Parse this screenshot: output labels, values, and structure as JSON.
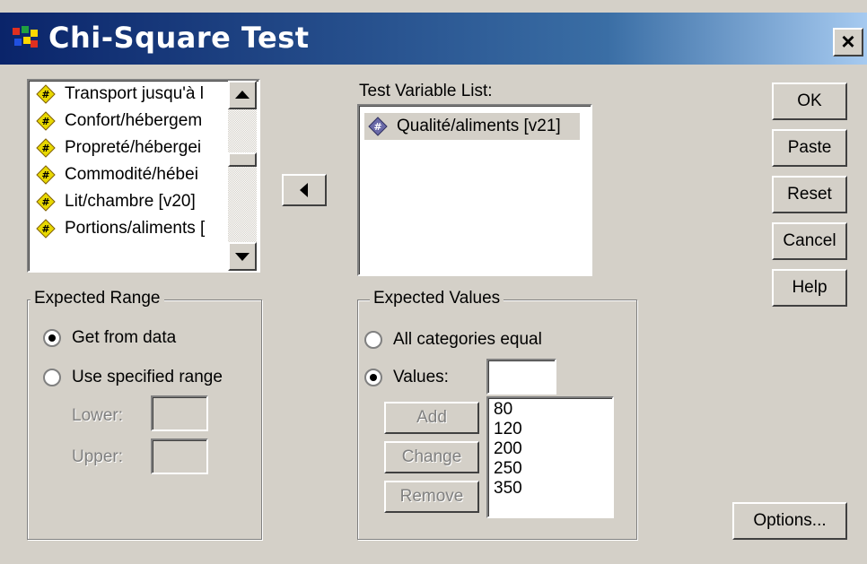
{
  "window": {
    "title": "Chi-Square Test",
    "close_label": "×"
  },
  "source_list": {
    "items": [
      {
        "label": "Transport jusqu'à l"
      },
      {
        "label": "Confort/hébergem"
      },
      {
        "label": "Propreté/hébergei"
      },
      {
        "label": "Commodité/hébei"
      },
      {
        "label": "Lit/chambre [v20]"
      },
      {
        "label": "Portions/aliments ["
      }
    ]
  },
  "move_button": {
    "icon": "arrow-left-icon"
  },
  "test_variables": {
    "label": "Test Variable List:",
    "items": [
      {
        "label": "Qualité/aliments [v21]"
      }
    ]
  },
  "buttons": {
    "ok": "OK",
    "paste": "Paste",
    "reset": "Reset",
    "cancel": "Cancel",
    "help": "Help",
    "options": "Options..."
  },
  "expected_range": {
    "title": "Expected Range",
    "get_from_data": "Get from data",
    "use_specified": "Use specified range",
    "selected": "get_from_data",
    "lower_label": "Lower:",
    "upper_label": "Upper:",
    "lower_value": "",
    "upper_value": ""
  },
  "expected_values": {
    "title": "Expected Values",
    "all_equal": "All categories equal",
    "values_label": "Values:",
    "selected": "values",
    "value_input": "",
    "add": "Add",
    "change": "Change",
    "remove": "Remove",
    "values_list": [
      "80",
      "120",
      "200",
      "250",
      "350"
    ]
  },
  "colors": {
    "title_bar_start": "#0a246a",
    "title_bar_end": "#a6caf0",
    "dialog_face": "#d4d0c8",
    "variable_icon": "#e8d800",
    "selected_variable_icon": "#6a6aa8"
  }
}
